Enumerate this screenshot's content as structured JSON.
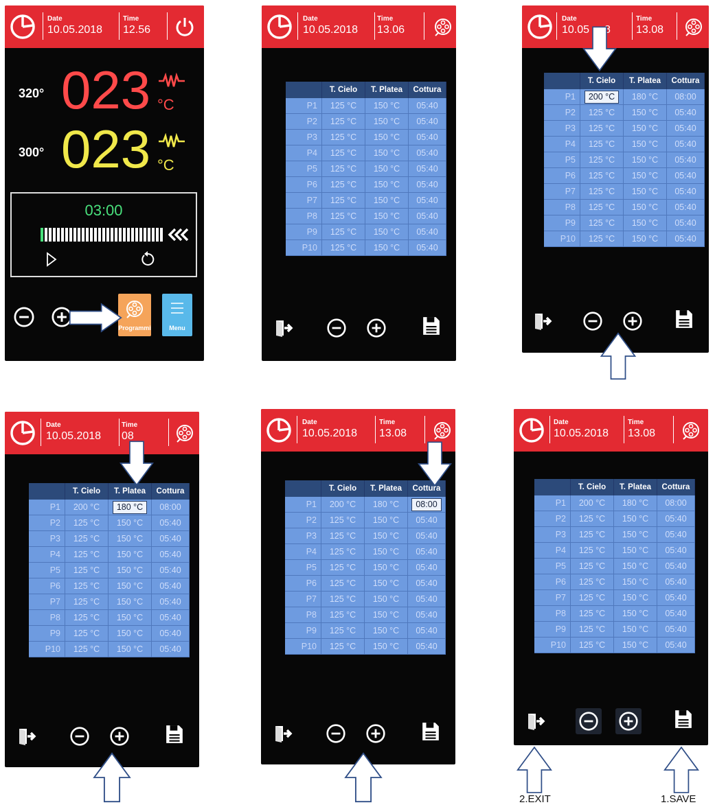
{
  "colors": {
    "header": "#e32a32",
    "cell": "#6e9be0",
    "header_row": "#2c4a7a",
    "temp_red": "#ff4a4a",
    "temp_yellow": "#f0e84a",
    "timer_green": "#49e07c"
  },
  "panel1": {
    "date_label": "Date",
    "date": "10.05.2018",
    "time_label": "Time",
    "time": "12.56",
    "upper": {
      "set": "320°",
      "value": "023",
      "unit": "°C"
    },
    "lower": {
      "set": "300°",
      "value": "023",
      "unit": "°C"
    },
    "timer": "03:00",
    "programs_label": "Programmi",
    "menu_label": "Menu",
    "icons": [
      "clock-icon",
      "power-icon",
      "heater-icon",
      "play-icon",
      "reset-icon",
      "minus-icon",
      "plus-icon",
      "programs-icon",
      "menu-icon",
      "rewind-icon"
    ]
  },
  "table_headers": [
    "T. Cielo",
    "T. Platea",
    "Cottura"
  ],
  "screens": [
    {
      "date_label": "Date",
      "date": "10.05.2018",
      "time_label": "Time",
      "time": "13.06",
      "rows": [
        [
          "P1",
          "125 °C",
          "150 °C",
          "05:40"
        ],
        [
          "P2",
          "125 °C",
          "150 °C",
          "05:40"
        ],
        [
          "P3",
          "125 °C",
          "150 °C",
          "05:40"
        ],
        [
          "P4",
          "125 °C",
          "150 °C",
          "05:40"
        ],
        [
          "P5",
          "125 °C",
          "150 °C",
          "05:40"
        ],
        [
          "P6",
          "125 °C",
          "150 °C",
          "05:40"
        ],
        [
          "P7",
          "125 °C",
          "150 °C",
          "05:40"
        ],
        [
          "P8",
          "125 °C",
          "150 °C",
          "05:40"
        ],
        [
          "P9",
          "125 °C",
          "150 °C",
          "05:40"
        ],
        [
          "P10",
          "125 °C",
          "150 °C",
          "05:40"
        ]
      ]
    },
    {
      "date_label": "Date",
      "date": "10.05",
      "time_label": "Time",
      "time": "13.08",
      "date_tail": "8",
      "rows": [
        [
          "P1",
          "200 °C",
          "180 °C",
          "08:00"
        ],
        [
          "P2",
          "125 °C",
          "150 °C",
          "05:40"
        ],
        [
          "P3",
          "125 °C",
          "150 °C",
          "05:40"
        ],
        [
          "P4",
          "125 °C",
          "150 °C",
          "05:40"
        ],
        [
          "P5",
          "125 °C",
          "150 °C",
          "05:40"
        ],
        [
          "P6",
          "125 °C",
          "150 °C",
          "05:40"
        ],
        [
          "P7",
          "125 °C",
          "150 °C",
          "05:40"
        ],
        [
          "P8",
          "125 °C",
          "150 °C",
          "05:40"
        ],
        [
          "P9",
          "125 °C",
          "150 °C",
          "05:40"
        ],
        [
          "P10",
          "125 °C",
          "150 °C",
          "05:40"
        ]
      ]
    },
    {
      "date_label": "Date",
      "date": "10.05.2018",
      "time_label": "Time",
      "time": "08",
      "rows": [
        [
          "P1",
          "200 °C",
          "180 °C",
          "08:00"
        ],
        [
          "P2",
          "125 °C",
          "150 °C",
          "05:40"
        ],
        [
          "P3",
          "125 °C",
          "150 °C",
          "05:40"
        ],
        [
          "P4",
          "125 °C",
          "150 °C",
          "05:40"
        ],
        [
          "P5",
          "125 °C",
          "150 °C",
          "05:40"
        ],
        [
          "P6",
          "125 °C",
          "150 °C",
          "05:40"
        ],
        [
          "P7",
          "125 °C",
          "150 °C",
          "05:40"
        ],
        [
          "P8",
          "125 °C",
          "150 °C",
          "05:40"
        ],
        [
          "P9",
          "125 °C",
          "150 °C",
          "05:40"
        ],
        [
          "P10",
          "125 °C",
          "150 °C",
          "05:40"
        ]
      ]
    },
    {
      "date_label": "Date",
      "date": "10.05.2018",
      "time_label": "Time",
      "time": "13.08",
      "rows": [
        [
          "P1",
          "200 °C",
          "180 °C",
          "08:00"
        ],
        [
          "P2",
          "125 °C",
          "150 °C",
          "05:40"
        ],
        [
          "P3",
          "125 °C",
          "150 °C",
          "05:40"
        ],
        [
          "P4",
          "125 °C",
          "150 °C",
          "05:40"
        ],
        [
          "P5",
          "125 °C",
          "150 °C",
          "05:40"
        ],
        [
          "P6",
          "125 °C",
          "150 °C",
          "05:40"
        ],
        [
          "P7",
          "125 °C",
          "150 °C",
          "05:40"
        ],
        [
          "P8",
          "125 °C",
          "150 °C",
          "05:40"
        ],
        [
          "P9",
          "125 °C",
          "150 °C",
          "05:40"
        ],
        [
          "P10",
          "125 °C",
          "150 °C",
          "05:40"
        ]
      ]
    },
    {
      "date_label": "Date",
      "date": "10.05.2018",
      "time_label": "Time",
      "time": "13.08",
      "rows": [
        [
          "P1",
          "200 °C",
          "180 °C",
          "08:00"
        ],
        [
          "P2",
          "125 °C",
          "150 °C",
          "05:40"
        ],
        [
          "P3",
          "125 °C",
          "150 °C",
          "05:40"
        ],
        [
          "P4",
          "125 °C",
          "150 °C",
          "05:40"
        ],
        [
          "P5",
          "125 °C",
          "150 °C",
          "05:40"
        ],
        [
          "P6",
          "125 °C",
          "150 °C",
          "05:40"
        ],
        [
          "P7",
          "125 °C",
          "150 °C",
          "05:40"
        ],
        [
          "P8",
          "125 °C",
          "150 °C",
          "05:40"
        ],
        [
          "P9",
          "125 °C",
          "150 °C",
          "05:40"
        ],
        [
          "P10",
          "125 °C",
          "150 °C",
          "05:40"
        ]
      ]
    }
  ],
  "annotations": {
    "exit": "2.EXIT",
    "save": "1.SAVE"
  }
}
